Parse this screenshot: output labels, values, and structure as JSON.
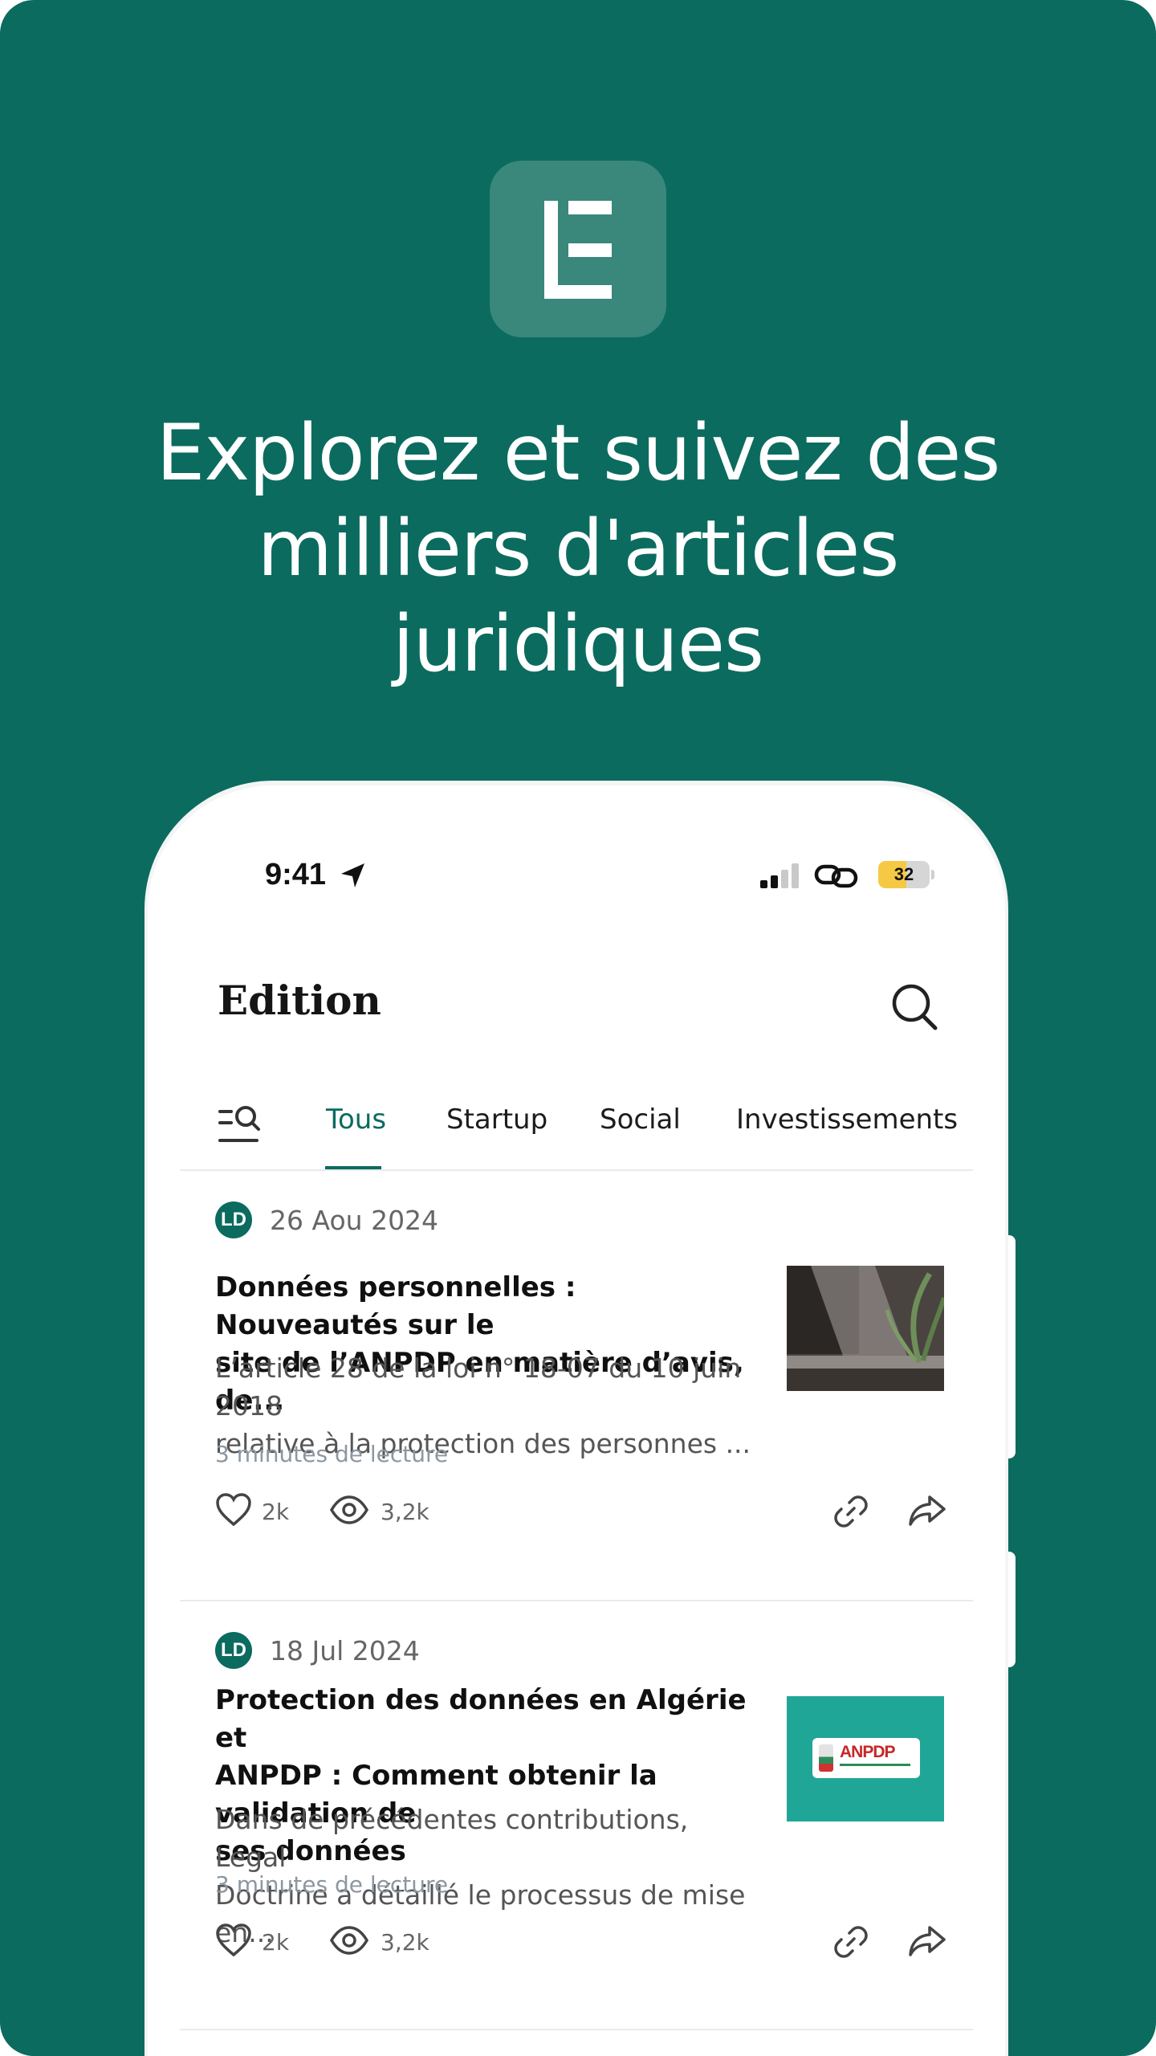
{
  "colors": {
    "brand_green": "#0b6b5f",
    "logo_tile": "#3a877b",
    "thumb_teal": "#1fa696"
  },
  "promo": {
    "logo_icon": "legal-doctrine-logo-icon",
    "headline_lines": [
      "Explorez et suivez des",
      "milliers d'articles",
      "juridiques"
    ]
  },
  "status_bar": {
    "time": "9:41",
    "battery": "32"
  },
  "app": {
    "title": "Edition",
    "search_icon": "search-icon",
    "tabs": [
      "Tous",
      "Startup",
      "Social",
      "Investissements"
    ],
    "active_tab": "Tous"
  },
  "articles": [
    {
      "date": "26 Aou 2024",
      "source_badge": "LD",
      "title_lines": [
        "Données personnelles : Nouveautés sur le",
        "site de l’ANPDP en matière d’avis, de..."
      ],
      "summary_lines": [
        "L’article 28 de la loi n° 18-07 du 10 juin 2018",
        "relative à la protection des personnes ..."
      ],
      "read_time": "3 minutes de lecture",
      "likes": "2k",
      "views": "3,2k"
    },
    {
      "date": "18 Jul 2024",
      "source_badge": "LD",
      "title_lines": [
        "Protection des données en Algérie et",
        "ANPDP : Comment obtenir la validation de",
        "ses données"
      ],
      "summary_lines": [
        "Dans de précédentes contributions, Legal",
        "Doctrine a détaillé le processus de mise en..."
      ],
      "read_time": "3 minutes de lecture",
      "likes": "2k",
      "views": "3,2k",
      "thumb_text": "ANPDP"
    }
  ]
}
